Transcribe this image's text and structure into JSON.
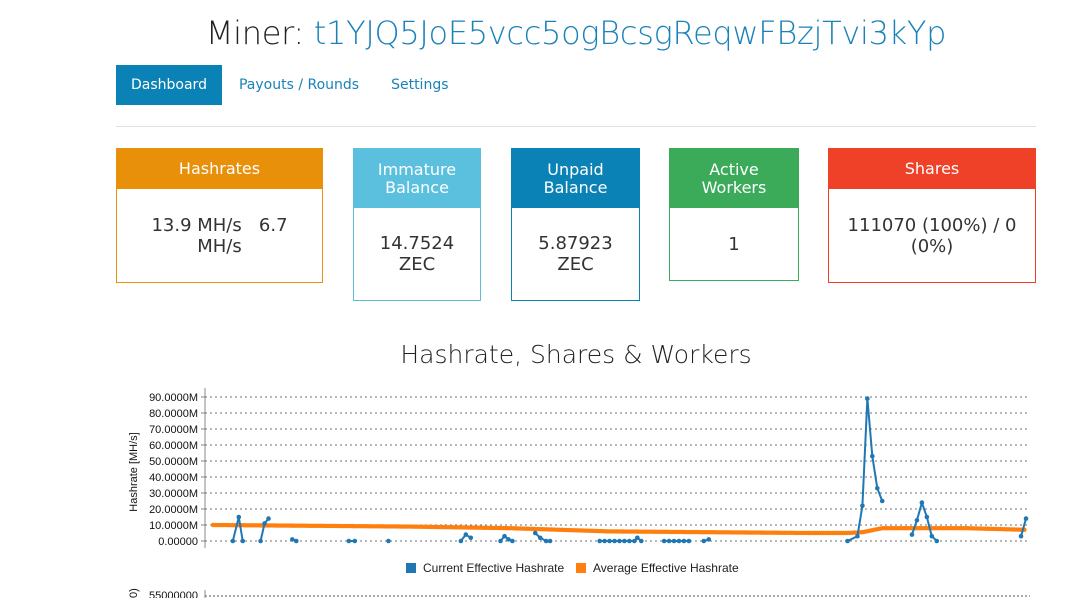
{
  "header": {
    "label": "Miner:",
    "address": "t1YJQ5JoE5vcc5ogBcsgReqwFBzjTvi3kYp"
  },
  "nav": {
    "tabs": [
      "Dashboard",
      "Payouts / Rounds",
      "Settings"
    ]
  },
  "cards": {
    "hashrates": {
      "title": "Hashrates",
      "line1": "13.9 MH/s   6.7",
      "line2": "MH/s",
      "color": "#e8900a"
    },
    "immature": {
      "title_line1": "Immature",
      "title_line2": "Balance",
      "line1": "14.7524",
      "line2": "ZEC",
      "color": "#5bc0de"
    },
    "unpaid": {
      "title_line1": "Unpaid",
      "title_line2": "Balance",
      "line1": "5.87923",
      "line2": "ZEC",
      "color": "#0b82b6"
    },
    "workers": {
      "title_line1": "Active",
      "title_line2": "Workers",
      "value": "1",
      "color": "#3bab5a"
    },
    "shares": {
      "title": "Shares",
      "line1": "111070 (100%) / 0",
      "line2": "(0%)",
      "color": "#ee4128"
    }
  },
  "chart": {
    "title": "Hashrate, Shares & Workers",
    "ylabel": "Hashrate [MH/s]",
    "yticks": [
      "90.0000M",
      "80.0000M",
      "70.0000M",
      "60.0000M",
      "50.0000M",
      "40.0000M",
      "30.0000M",
      "20.0000M",
      "10.0000M",
      "0.00000"
    ],
    "legend": [
      "Current Effective Hashrate",
      "Average Effective Hashrate"
    ],
    "second_chart_first_tick": "55000000",
    "colors": {
      "current": "#1f77b4",
      "average": "#ff7f0e"
    }
  },
  "chart_data": {
    "type": "line",
    "ylabel": "Hashrate [MH/s]",
    "ylim": [
      0,
      90
    ],
    "grid": true,
    "legend": "bottom",
    "series": [
      {
        "name": "Current Effective Hashrate",
        "values": [
          [
            20,
            0
          ],
          [
            26,
            15
          ],
          [
            30,
            0
          ],
          [
            48,
            0
          ],
          [
            52,
            11
          ],
          [
            56,
            14
          ],
          [
            80,
            1
          ],
          [
            84,
            0
          ],
          [
            137,
            0
          ],
          [
            143,
            0
          ],
          [
            177,
            0
          ],
          [
            250,
            0
          ],
          [
            255,
            4
          ],
          [
            260,
            2
          ],
          [
            290,
            0
          ],
          [
            294,
            3
          ],
          [
            298,
            1
          ],
          [
            302,
            0
          ],
          [
            325,
            5
          ],
          [
            330,
            2
          ],
          [
            336,
            0
          ],
          [
            340,
            0
          ],
          [
            390,
            0
          ],
          [
            395,
            0
          ],
          [
            400,
            0
          ],
          [
            405,
            0
          ],
          [
            410,
            0
          ],
          [
            415,
            0
          ],
          [
            420,
            0
          ],
          [
            425,
            0
          ],
          [
            428,
            2
          ],
          [
            432,
            0
          ],
          [
            455,
            0
          ],
          [
            460,
            0
          ],
          [
            465,
            0
          ],
          [
            470,
            0
          ],
          [
            475,
            0
          ],
          [
            480,
            0
          ],
          [
            495,
            0
          ],
          [
            500,
            1
          ],
          [
            640,
            0
          ],
          [
            650,
            3
          ],
          [
            655,
            22
          ],
          [
            660,
            89
          ],
          [
            665,
            53
          ],
          [
            670,
            33
          ],
          [
            675,
            25
          ],
          [
            705,
            4
          ],
          [
            710,
            13
          ],
          [
            715,
            24
          ],
          [
            720,
            15
          ],
          [
            725,
            3
          ],
          [
            730,
            0
          ],
          [
            815,
            3
          ],
          [
            820,
            14
          ]
        ]
      },
      {
        "name": "Average Effective Hashrate",
        "values": [
          [
            0,
            10
          ],
          [
            100,
            9.5
          ],
          [
            200,
            9
          ],
          [
            300,
            8
          ],
          [
            400,
            6
          ],
          [
            500,
            5.5
          ],
          [
            600,
            5
          ],
          [
            640,
            5
          ],
          [
            655,
            5.5
          ],
          [
            675,
            8
          ],
          [
            760,
            8
          ],
          [
            820,
            7
          ]
        ]
      }
    ]
  }
}
